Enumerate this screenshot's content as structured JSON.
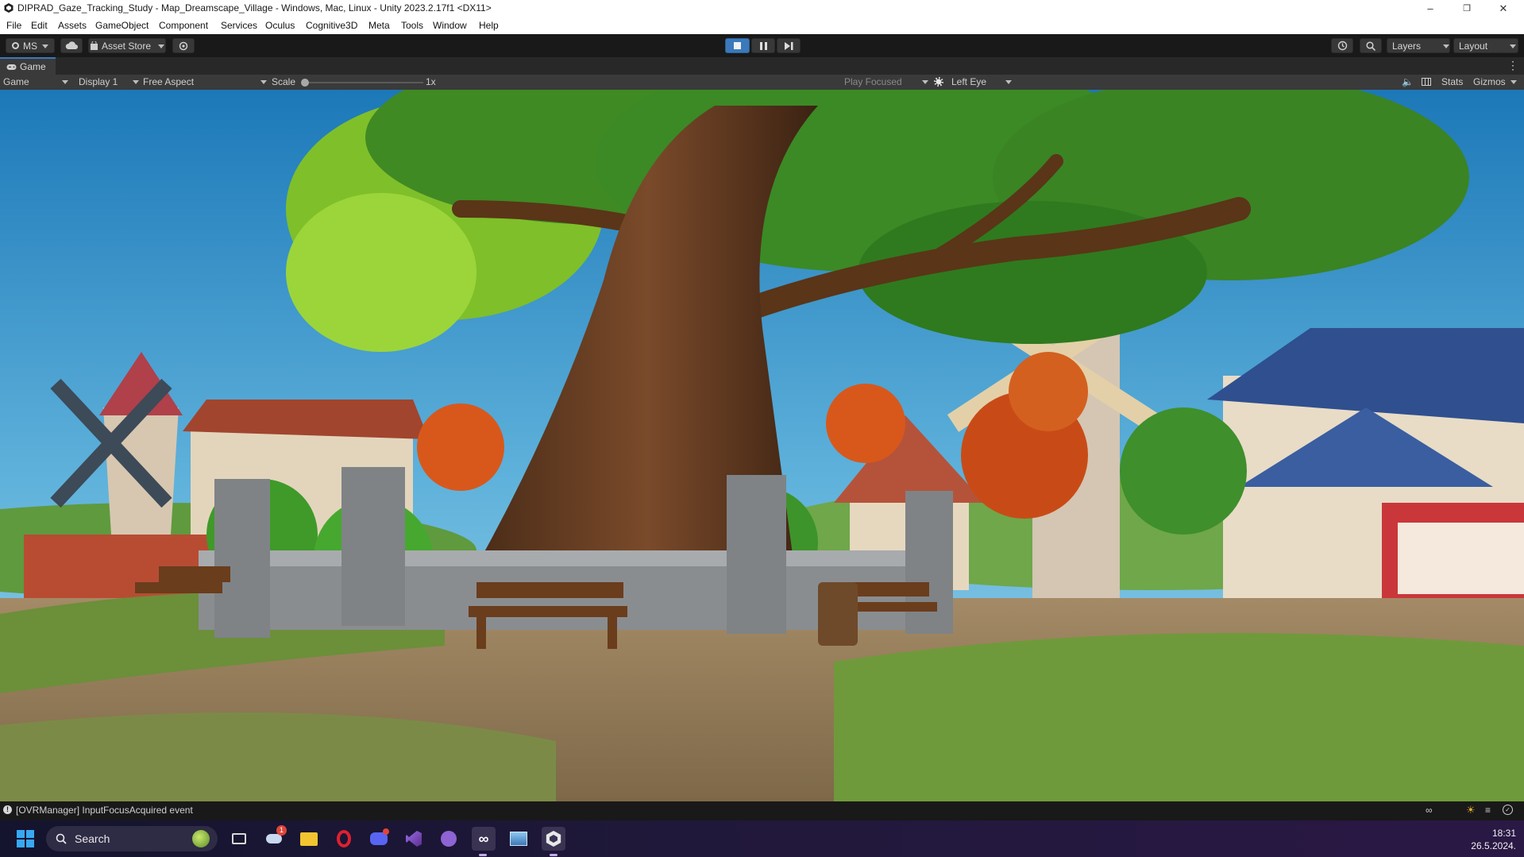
{
  "window": {
    "title": "DIPRAD_Gaze_Tracking_Study - Map_Dreamscape_Village - Windows, Mac, Linux - Unity 2023.2.17f1 <DX11>"
  },
  "menu": [
    "File",
    "Edit",
    "Assets",
    "GameObject",
    "Component",
    "Services",
    "Oculus",
    "Cognitive3D",
    "Meta",
    "Tools",
    "Window",
    "Help"
  ],
  "toolbar": {
    "account": "MS",
    "asset_store": "Asset Store",
    "layers": "Layers",
    "layout": "Layout"
  },
  "game_tab": {
    "label": "Game"
  },
  "game_toolbar": {
    "view": "Game",
    "display": "Display 1",
    "aspect": "Free Aspect",
    "scale_label": "Scale",
    "scale_value": "1x",
    "scale_level": 0,
    "play_mode": "Play Focused",
    "eye": "Left Eye",
    "stats": "Stats",
    "gizmos": "Gizmos"
  },
  "status": {
    "message": "[OVRManager] InputFocusAcquired event"
  },
  "taskbar": {
    "search_placeholder": "Search",
    "weather_badge": "1",
    "time": "18:31",
    "date": "26.5.2024."
  },
  "colors": {
    "unity_dark": "#191919",
    "play_active": "#3a79bb",
    "taskbar": "#1c1735"
  }
}
